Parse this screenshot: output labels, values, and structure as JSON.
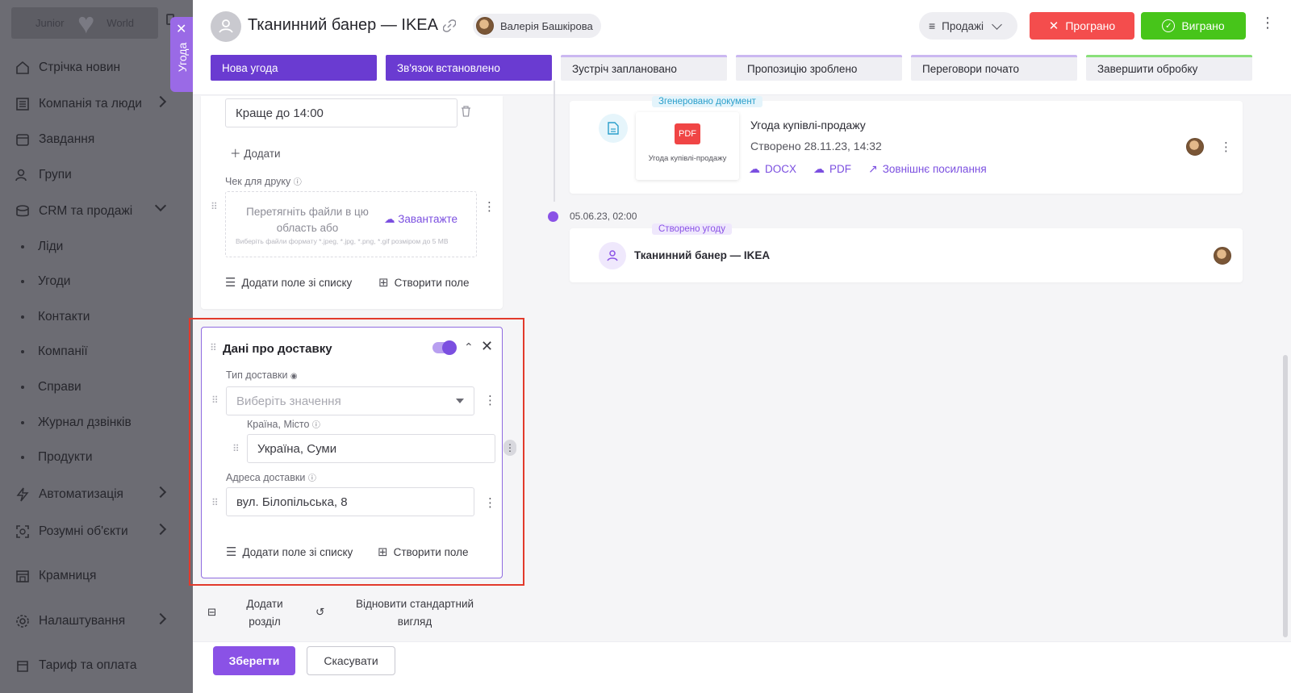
{
  "sidebar": {
    "logo_left": "Junior",
    "logo_right": "World",
    "items": [
      {
        "label": "Стрічка новин",
        "icon": "home-icon"
      },
      {
        "label": "Компанія та люди",
        "icon": "company-icon"
      },
      {
        "label": "Завдання",
        "icon": "calendar-icon"
      },
      {
        "label": "Групи",
        "icon": "groups-icon"
      },
      {
        "label": "CRM та продажі",
        "icon": "crm-icon"
      },
      {
        "label": "Автоматизація",
        "icon": "lightning-icon"
      },
      {
        "label": "Розумні об'єкти",
        "icon": "smart-objects-icon"
      },
      {
        "label": "Крамниця",
        "icon": "store-icon"
      },
      {
        "label": "Налаштування",
        "icon": "gear-icon"
      },
      {
        "label": "Тариф та оплата",
        "icon": "billing-icon"
      }
    ],
    "crm_subitems": [
      "Ліди",
      "Угоди",
      "Контакти",
      "Компанії",
      "Справи",
      "Журнал дзвінків",
      "Продукти"
    ]
  },
  "deal_tab": {
    "label": "Угода"
  },
  "header": {
    "title": "Тканинний банер — IKEA",
    "owner": "Валерія Башкірова",
    "pipeline": "Продажі",
    "lost_label": "Програно",
    "won_label": "Виграно"
  },
  "stages": [
    {
      "label": "Нова угода",
      "state": "done"
    },
    {
      "label": "Зв'язок встановлено",
      "state": "done"
    },
    {
      "label": "Зустріч заплановано",
      "state": "todo"
    },
    {
      "label": "Пропозицію зроблено",
      "state": "todo"
    },
    {
      "label": "Переговори почато",
      "state": "todo"
    },
    {
      "label": "Завершити обробку",
      "state": "final"
    }
  ],
  "form": {
    "time_value": "Краще до 14:00",
    "add_label": "Додати",
    "receipt_label": "Чек для друку",
    "drop_text": "Перетягніть файли в цю область або",
    "upload_label": "Завантажте",
    "drop_hint": "Виберіть файли формату *.jpeg, *.jpg, *.png, *.gif розміром до 5 MB",
    "add_field_label": "Додати поле зі списку",
    "create_field_label": "Створити поле"
  },
  "delivery": {
    "title": "Дані про доставку",
    "type_label": "Тип доставки",
    "type_placeholder": "Виберіть значення",
    "country_label": "Країна, Місто",
    "country_value": "Україна, Суми",
    "address_label": "Адреса доставки",
    "address_value": "вул. Білопільська, 8",
    "add_field_label": "Додати поле зі списку",
    "create_field_label": "Створити поле"
  },
  "section_actions": {
    "add_section": "Додати розділ",
    "restore_view": "Відновити стандартний вигляд"
  },
  "bottom": {
    "save": "Зберегти",
    "cancel": "Скасувати"
  },
  "timeline": {
    "doc_tag": "Згенеровано документ",
    "doc_thumb_badge": "PDF",
    "doc_thumb_caption": "Угода купівлі-продажу",
    "doc_title": "Угода купівлі-продажу",
    "doc_created": "Створено 28.11.23, 14:32",
    "link_docx": "DOCX",
    "link_pdf": "PDF",
    "link_external": "Зовнішнє посилання",
    "event_date": "05.06.23, 02:00",
    "deal_tag": "Створено угоду",
    "deal_title": "Тканинний банер — IKEA"
  }
}
